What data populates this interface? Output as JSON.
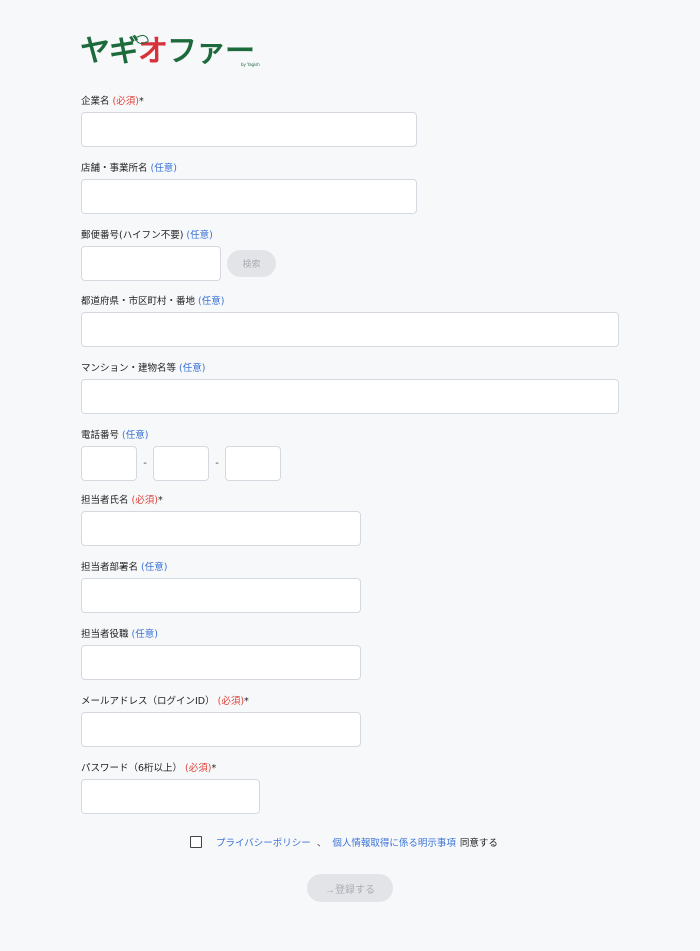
{
  "logo": {
    "part1": "ヤギ",
    "part2": "オ",
    "part3": "ファー",
    "sub": "by Yagish"
  },
  "required_tag": "(必須)",
  "optional_tag": "(任意)",
  "required_star": "*",
  "fields": {
    "company": {
      "label": "企業名",
      "value": "",
      "placeholder": ""
    },
    "store": {
      "label": "店舗・事業所名",
      "value": "",
      "placeholder": ""
    },
    "postal": {
      "label": "郵便番号(ハイフン不要)",
      "value": "",
      "placeholder": "",
      "search_label": "検索"
    },
    "address": {
      "label": "都道府県・市区町村・番地",
      "value": "",
      "placeholder": ""
    },
    "building": {
      "label": "マンション・建物名等",
      "value": "",
      "placeholder": ""
    },
    "phone": {
      "label": "電話番号",
      "part1": "",
      "part2": "",
      "part3": "",
      "dash": "-"
    },
    "contact_name": {
      "label": "担当者氏名",
      "value": "",
      "placeholder": ""
    },
    "department": {
      "label": "担当者部署名",
      "value": "",
      "placeholder": ""
    },
    "position": {
      "label": "担当者役職",
      "value": "",
      "placeholder": ""
    },
    "email": {
      "label": "メールアドレス（ログインID）",
      "value": "",
      "placeholder": ""
    },
    "password": {
      "label": "パスワード（6桁以上）",
      "value": "",
      "placeholder": ""
    }
  },
  "consent": {
    "checked": false,
    "privacy_link": "プライバシーポリシー",
    "separator": "、",
    "disclosure_link": "個人情報取得に係る明示事項",
    "agree_text": "同意する"
  },
  "submit_label": "→登録する",
  "colors": {
    "brand_green": "#1d6a3c",
    "brand_red": "#d6323a",
    "required": "#e0413a",
    "optional": "#3b73d6"
  }
}
